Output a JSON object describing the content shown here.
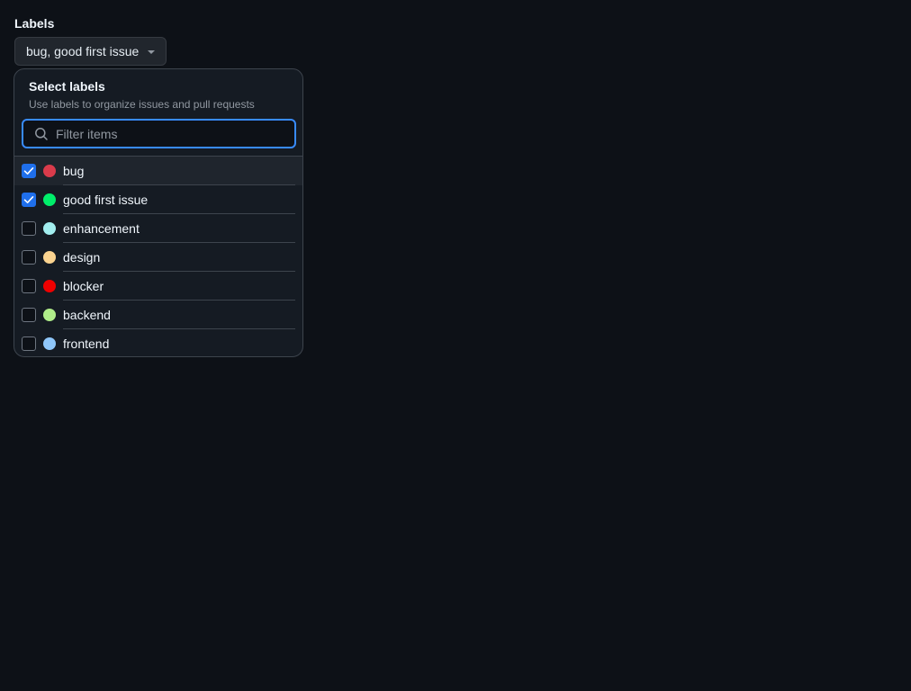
{
  "field": {
    "label": "Labels",
    "selected_text": "bug, good first issue"
  },
  "panel": {
    "title": "Select labels",
    "subtitle": "Use labels to organize issues and pull requests",
    "filter_placeholder": "Filter items",
    "filter_value": "",
    "items": [
      {
        "label": "bug",
        "color": "#da3b4b",
        "checked": true,
        "active": true
      },
      {
        "label": "good first issue",
        "color": "#00ee6a",
        "checked": true,
        "active": false
      },
      {
        "label": "enhancement",
        "color": "#a2eeef",
        "checked": false,
        "active": false
      },
      {
        "label": "design",
        "color": "#fad38f",
        "checked": false,
        "active": false
      },
      {
        "label": "blocker",
        "color": "#ee0000",
        "checked": false,
        "active": false
      },
      {
        "label": "backend",
        "color": "#b0ed8a",
        "checked": false,
        "active": false
      },
      {
        "label": "frontend",
        "color": "#8fc7fa",
        "checked": false,
        "active": false
      }
    ]
  },
  "icons": {
    "search": "search-icon",
    "caret": "caret-down-icon",
    "check": "check-icon"
  }
}
